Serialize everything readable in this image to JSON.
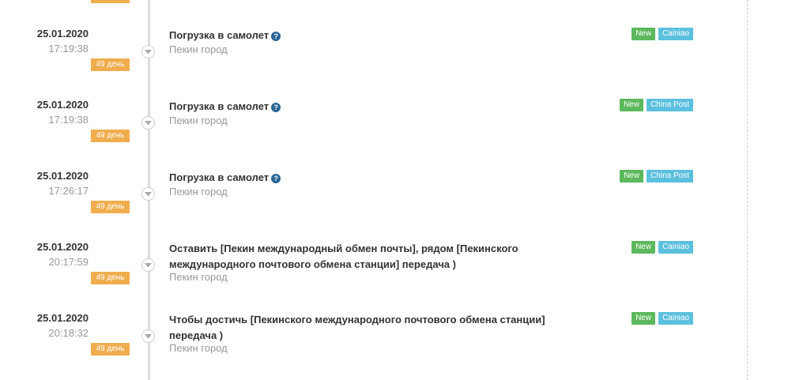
{
  "events": [
    {
      "date": "25.01.2020",
      "time": "17:19:38",
      "days": "49 день",
      "title": "Погрузка в самолет",
      "has_help": true,
      "location": "Пекин город",
      "status_badge": "New",
      "carrier_badge": "Cainiao"
    },
    {
      "date": "25.01.2020",
      "time": "17:19:38",
      "days": "49 день",
      "title": "Погрузка в самолет",
      "has_help": true,
      "location": "Пекин город",
      "status_badge": "New",
      "carrier_badge": "China Post"
    },
    {
      "date": "25.01.2020",
      "time": "17:26:17",
      "days": "49 день",
      "title": "Погрузка в самолет",
      "has_help": true,
      "location": "Пекин город",
      "status_badge": "New",
      "carrier_badge": "China Post"
    },
    {
      "date": "25.01.2020",
      "time": "20:17:59",
      "days": "49 день",
      "title_line1": "Оставить [Пекин международный обмен почты], рядом [Пекинского",
      "title_line2": "международного почтового обмена станции] передача )",
      "has_help": false,
      "location": "Пекин город",
      "status_badge": "New",
      "carrier_badge": "Cainiao"
    },
    {
      "date": "25.01.2020",
      "time": "20:18:32",
      "days": "49 день",
      "title_line1": "Чтобы достичь [Пекинского международного почтового обмена станции]",
      "title_line2": "передача )",
      "has_help": false,
      "location": "Пекин город",
      "status_badge": "New",
      "carrier_badge": "Cainiao"
    }
  ],
  "colors": {
    "days_badge": "#f0ad4e",
    "new_badge": "#5cb85c",
    "carrier_badge": "#5bc0de",
    "help_icon": "#2a6496",
    "timeline": "#dcdcdc"
  },
  "icons": {
    "node": "chevron-down-icon",
    "help": "question-circle-icon"
  }
}
